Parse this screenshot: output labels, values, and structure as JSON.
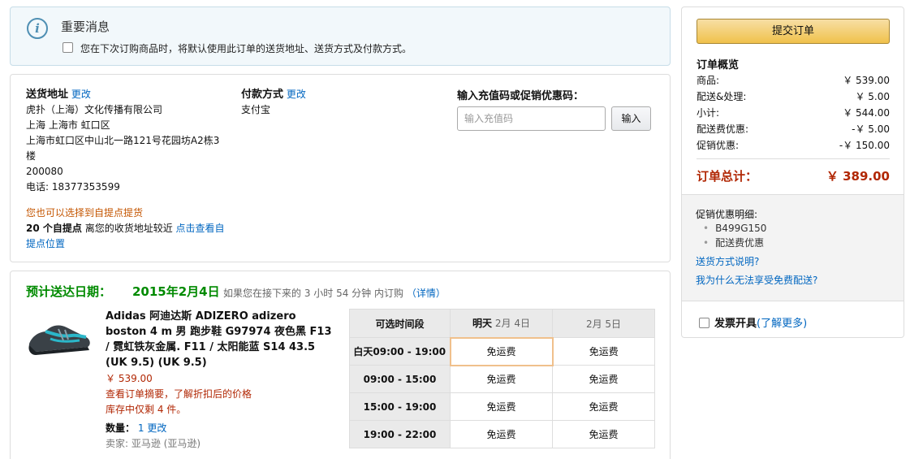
{
  "notice": {
    "icon": "info-icon",
    "title": "重要消息",
    "checkbox_label": "您在下次订购商品时，将默认使用此订单的送货地址、送货方式及付款方式。"
  },
  "address": {
    "heading": "送货地址",
    "change": "更改",
    "company": "虎扑（上海）文化传播有限公司",
    "region": "上海 上海市 虹口区",
    "street": "上海市虹口区中山北一路121号花园坊A2栋3楼",
    "zip": "200080",
    "phone": "电话: 18377353599",
    "pickup_note": "您也可以选择到自提点提货",
    "pickup_count": "20 个自提点",
    "pickup_text": " 离您的收货地址较近 ",
    "pickup_link": "点击查看自提点位置"
  },
  "payment": {
    "heading": "付款方式",
    "change": "更改",
    "method": "支付宝"
  },
  "coupon": {
    "heading": "输入充值码或促销优惠码：",
    "placeholder": "输入充值码",
    "button": "输入"
  },
  "delivery": {
    "title": "预计送达日期：",
    "date": "2015年2月4日",
    "note": "如果您在接下来的 3 小时 54 分钟 内订购",
    "details": "（详情）"
  },
  "product": {
    "name": "Adidas 阿迪达斯 ADIZERO adizero boston 4 m 男 跑步鞋 G97974 夜色黑 F13 / 霓虹铁灰金属. F11 / 太阳能蓝 S14 43.5 (UK 9.5) (UK 9.5)",
    "price": "￥ 539.00",
    "summary_link": "查看订单摘要，了解折扣后的价格",
    "stock": "库存中仅剩 4 件。",
    "qty_label": "数量：",
    "qty_value": "1",
    "qty_change": "更改",
    "seller": "卖家:  亚马逊 (亚马逊)"
  },
  "slots": {
    "header": "可选时间段",
    "col1_label": "明天",
    "col1_date": "2月 4日",
    "col2_date": "2月 5日",
    "rows": [
      {
        "time": "白天09:00 - 19:00",
        "c1": "免运费",
        "c2": "免运费"
      },
      {
        "time": "09:00 - 15:00",
        "c1": "免运费",
        "c2": "免运费"
      },
      {
        "time": "15:00 - 19:00",
        "c1": "免运费",
        "c2": "免运费"
      },
      {
        "time": "19:00 - 22:00",
        "c1": "免运费",
        "c2": "免运费"
      }
    ]
  },
  "summary": {
    "place_order": "提交订单",
    "title": "订单概览",
    "rows": [
      {
        "label": "商品:",
        "value": "￥ 539.00"
      },
      {
        "label": "配送&处理:",
        "value": "￥ 5.00"
      },
      {
        "label": "小计:",
        "value": "￥ 544.00"
      },
      {
        "label": "配送费优惠:",
        "value": "-￥ 5.00"
      },
      {
        "label": "促销优惠:",
        "value": "-￥ 150.00"
      }
    ],
    "total_label": "订单总计：",
    "total_value": "￥ 389.00",
    "promo_title": "促销优惠明细:",
    "promo_items": [
      "B499G150",
      "配送费优惠"
    ],
    "shipping_link": "送货方式说明?",
    "free_link": "我为什么无法享受免费配送?",
    "invoice_label": "发票开具",
    "invoice_link": "(了解更多)"
  }
}
